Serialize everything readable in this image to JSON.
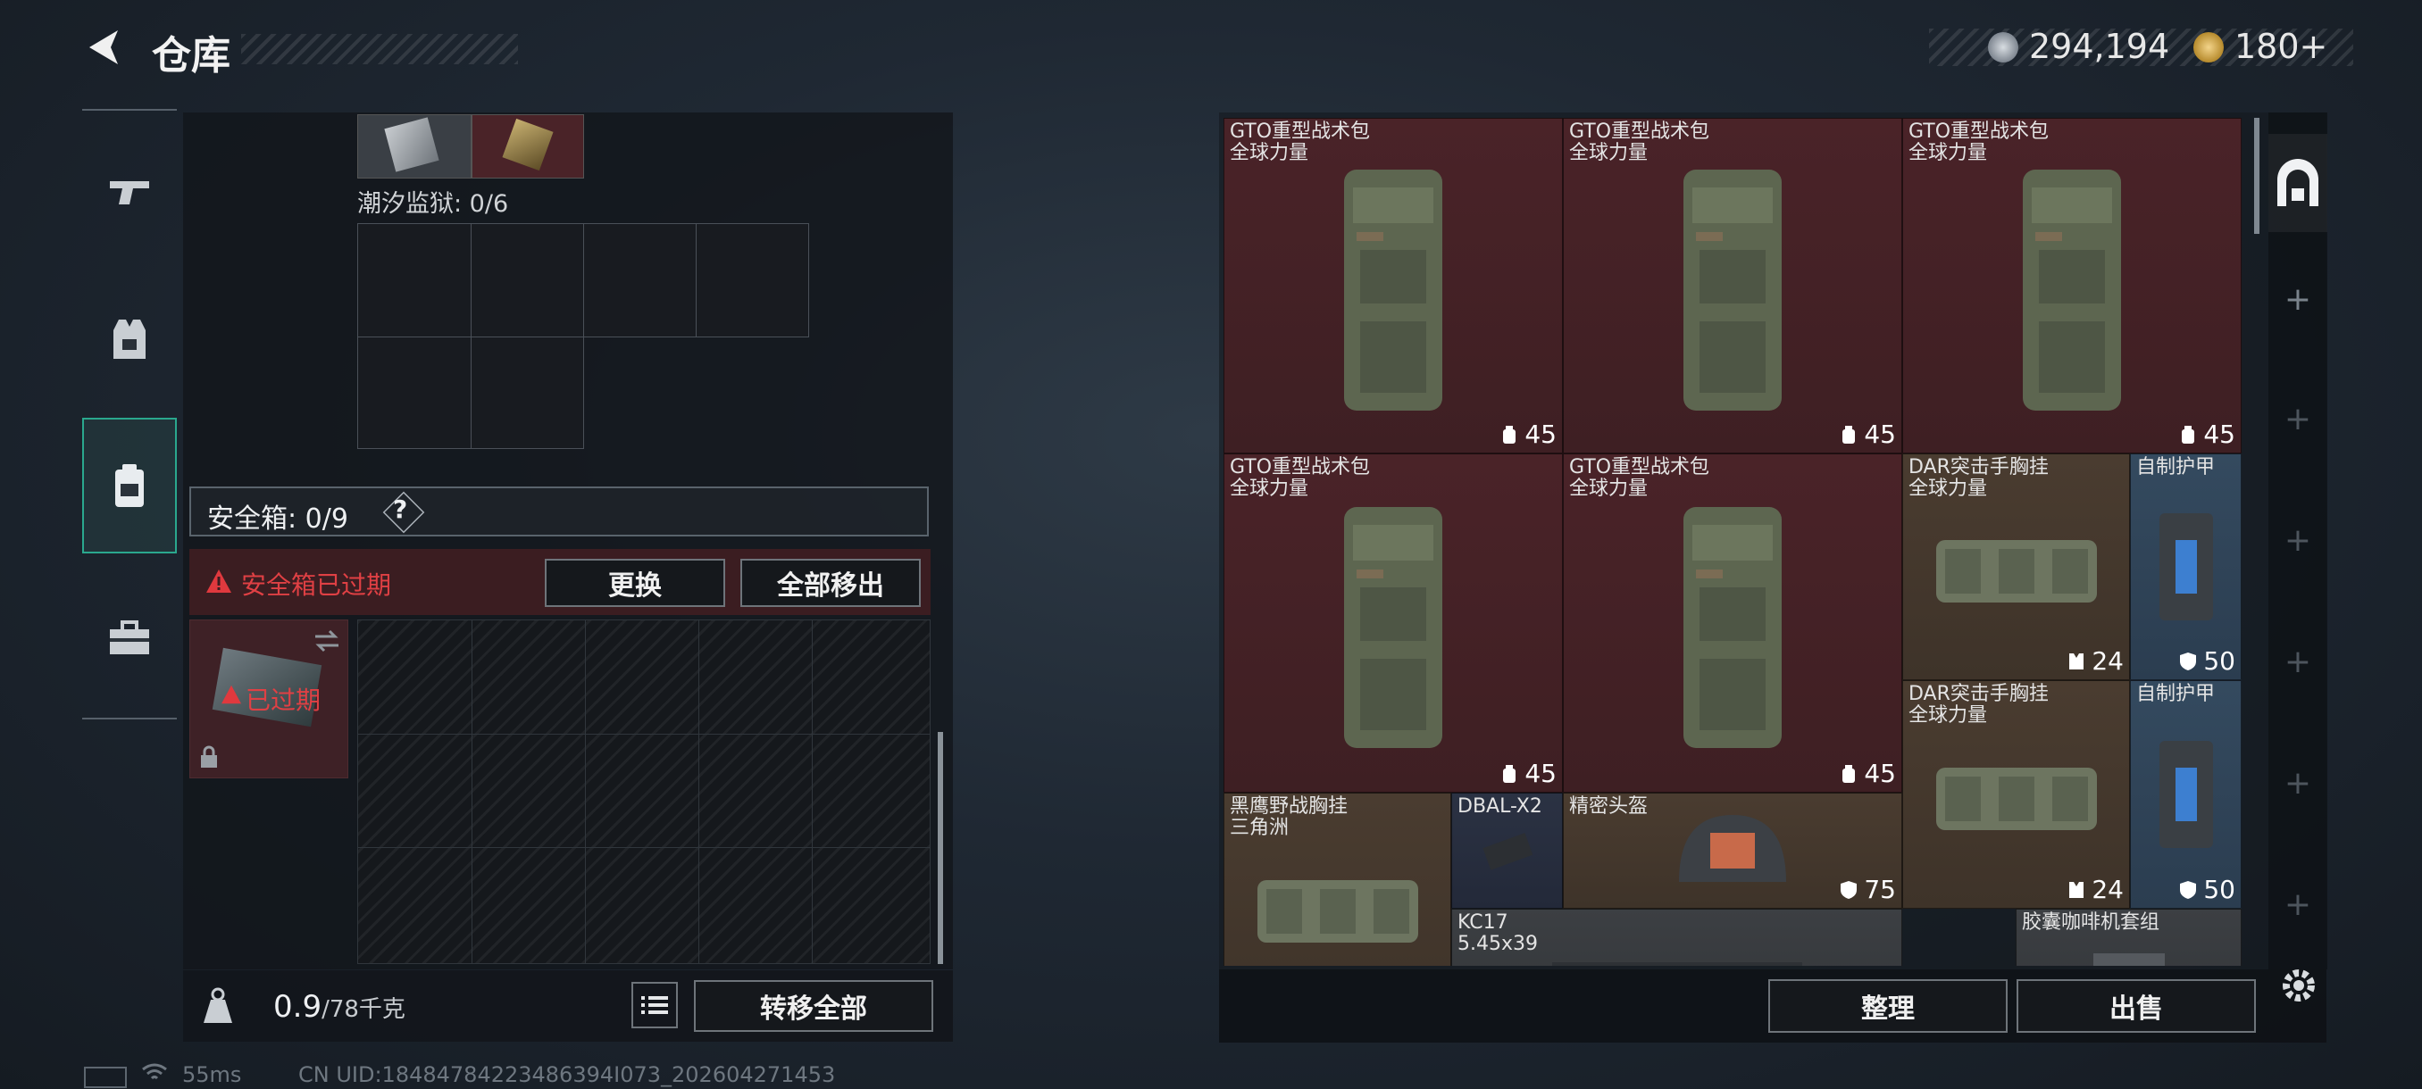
{
  "header": {
    "title": "仓库",
    "currency_main": "294,194",
    "currency_secondary": "180+"
  },
  "left": {
    "prison_label": "潮汐监狱: 0/6",
    "safebox_label": "安全箱: 0/9",
    "help_label": "?",
    "expired_alert": "安全箱已过期",
    "replace_button": "更换",
    "remove_all_button": "全部移出",
    "expired_badge": "已过期",
    "weight_value": "0.9",
    "weight_capacity": "/78千克",
    "transfer_all_button": "转移全部"
  },
  "items": [
    {
      "name": "GTO重型战术包",
      "source": "全球力量",
      "value": "45",
      "icon": "backpack-icon",
      "color": "red"
    },
    {
      "name": "GTO重型战术包",
      "source": "全球力量",
      "value": "45",
      "icon": "backpack-icon",
      "color": "red"
    },
    {
      "name": "GTO重型战术包",
      "source": "全球力量",
      "value": "45",
      "icon": "backpack-icon",
      "color": "red"
    },
    {
      "name": "GTO重型战术包",
      "source": "全球力量",
      "value": "45",
      "icon": "backpack-icon",
      "color": "red"
    },
    {
      "name": "GTO重型战术包",
      "source": "全球力量",
      "value": "45",
      "icon": "backpack-icon",
      "color": "red"
    },
    {
      "name": "DAR突击手胸挂",
      "source": "全球力量",
      "value": "24",
      "icon": "chest-rig-icon",
      "color": "brown"
    },
    {
      "name": "自制护甲",
      "source": "",
      "value": "50",
      "icon": "armor-icon",
      "color": "blue"
    },
    {
      "name": "DAR突击手胸挂",
      "source": "全球力量",
      "value": "24",
      "icon": "chest-rig-icon",
      "color": "brown"
    },
    {
      "name": "自制护甲",
      "source": "",
      "value": "50",
      "icon": "armor-icon",
      "color": "blue"
    },
    {
      "name": "黑鹰野战胸挂",
      "source": "三角洲",
      "value": "",
      "icon": "chest-rig-icon",
      "color": "brown"
    },
    {
      "name": "DBAL-X2",
      "source": "",
      "value": "",
      "icon": "laser-module-icon",
      "color": "navy"
    },
    {
      "name": "精密头盔",
      "source": "",
      "value": "75",
      "icon": "helmet-icon",
      "color": "brown"
    },
    {
      "name": "KC17",
      "source": "5.45x39",
      "value": "",
      "icon": "rifle-icon",
      "color": "gray"
    },
    {
      "name": "胶囊咖啡机套组",
      "source": "",
      "value": "",
      "icon": "coffee-machine-icon",
      "color": "gray"
    }
  ],
  "right": {
    "sort_button": "整理",
    "sell_button": "出售"
  },
  "status": {
    "ping": "55ms",
    "uid": "CN UID:18484784223486394I073_202604271453"
  },
  "colors": {
    "accent_teal": "#2aa88e",
    "alert_red": "#e0393e",
    "item_red": "#4a2328",
    "item_brown": "#4a3c30",
    "item_blue": "#344a5f"
  }
}
